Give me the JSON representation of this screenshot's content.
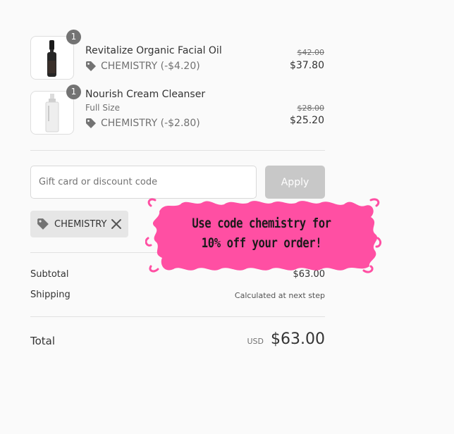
{
  "items": [
    {
      "name": "Revitalize Organic Facial Oil",
      "variant": "",
      "quantity": "1",
      "discount": "CHEMISTRY (-$4.20)",
      "original_price": "$42.00",
      "price": "$37.80"
    },
    {
      "name": "Nourish Cream Cleanser",
      "variant": "Full Size",
      "quantity": "1",
      "discount": "CHEMISTRY (-$2.80)",
      "original_price": "$28.00",
      "price": "$25.20"
    }
  ],
  "discount_form": {
    "placeholder": "Gift card or discount code",
    "apply_label": "Apply"
  },
  "applied_code": {
    "code": "CHEMISTRY"
  },
  "summary": {
    "subtotal_label": "Subtotal",
    "subtotal_value": "$63.00",
    "shipping_label": "Shipping",
    "shipping_value": "Calculated at next step",
    "total_label": "Total",
    "currency": "USD",
    "total_value": "$63.00"
  },
  "promo": {
    "line1": "Use code chemistry for",
    "line2": "10% off your order!"
  },
  "colors": {
    "promo_pink": "#ff4fa3",
    "apply_disabled": "#c8c8c8"
  }
}
